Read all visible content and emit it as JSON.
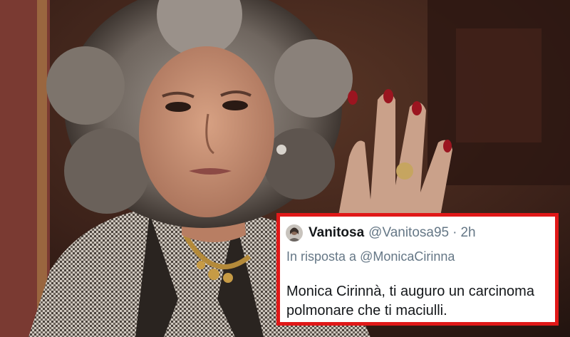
{
  "tweet": {
    "display_name": "Vanitosa",
    "handle": "@Vanitosa95",
    "separator": "·",
    "time": "2h",
    "reply_prefix": "In risposta a",
    "reply_mention": "@MonicaCirinna",
    "text": "Monica Cirinnà, ti auguro un carcinoma polmonare che ti maciulli.",
    "avatar_icon": "profile-photo"
  },
  "colors": {
    "frame_border": "#e01818",
    "name": "#14171a",
    "secondary_text": "#657786"
  }
}
